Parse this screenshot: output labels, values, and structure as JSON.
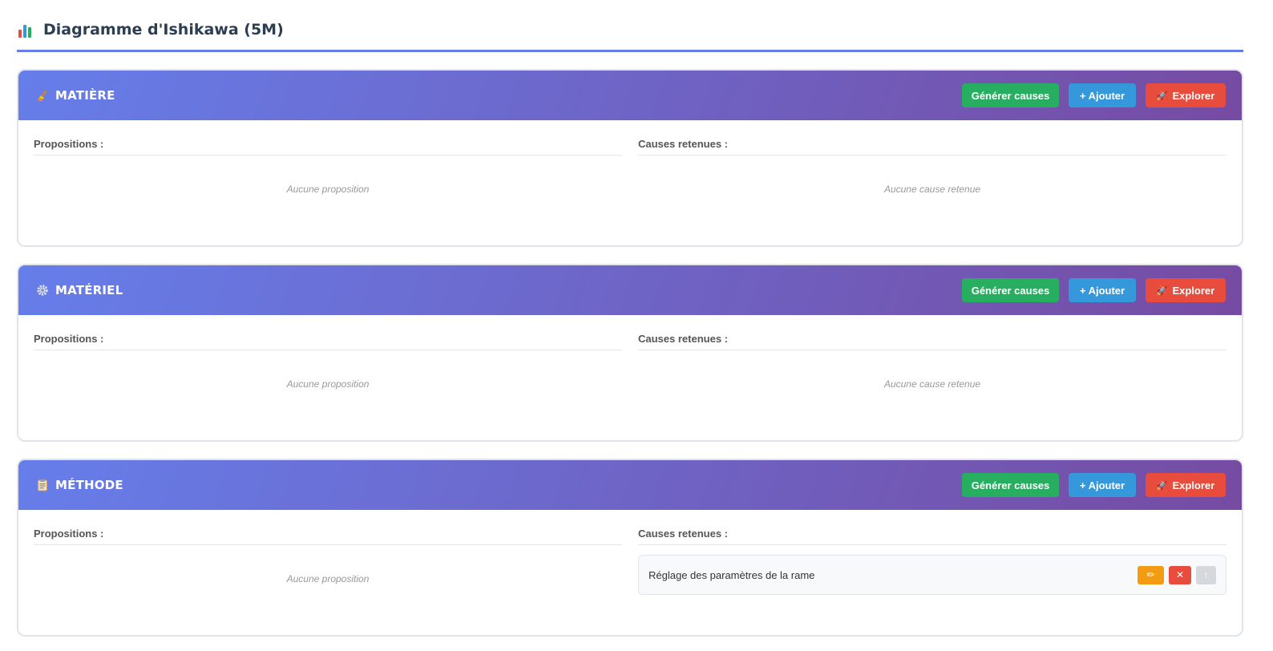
{
  "page": {
    "title": "Diagramme d'Ishikawa (5M)"
  },
  "labels": {
    "propositions": "Propositions :",
    "retained": "Causes retenues :",
    "no_proposition": "Aucune proposition",
    "no_retained": "Aucune cause retenue"
  },
  "buttons": {
    "generate": "Générer causes",
    "add": "+ Ajouter",
    "explore": "Explorer"
  },
  "categories": [
    {
      "title": "MATIÈRE",
      "icon": "broom-icon",
      "retained": []
    },
    {
      "title": "MATÉRIEL",
      "icon": "gear-icon",
      "retained": []
    },
    {
      "title": "MÉTHODE",
      "icon": "clipboard-icon",
      "retained": [
        "Réglage des paramètres de la rame"
      ]
    }
  ],
  "colors": {
    "accent": "#667eea",
    "header_gradient_end": "#764ba2",
    "generate": "#27ae60",
    "add": "#3498db",
    "explore": "#e74c3c",
    "edit": "#f39c12"
  }
}
